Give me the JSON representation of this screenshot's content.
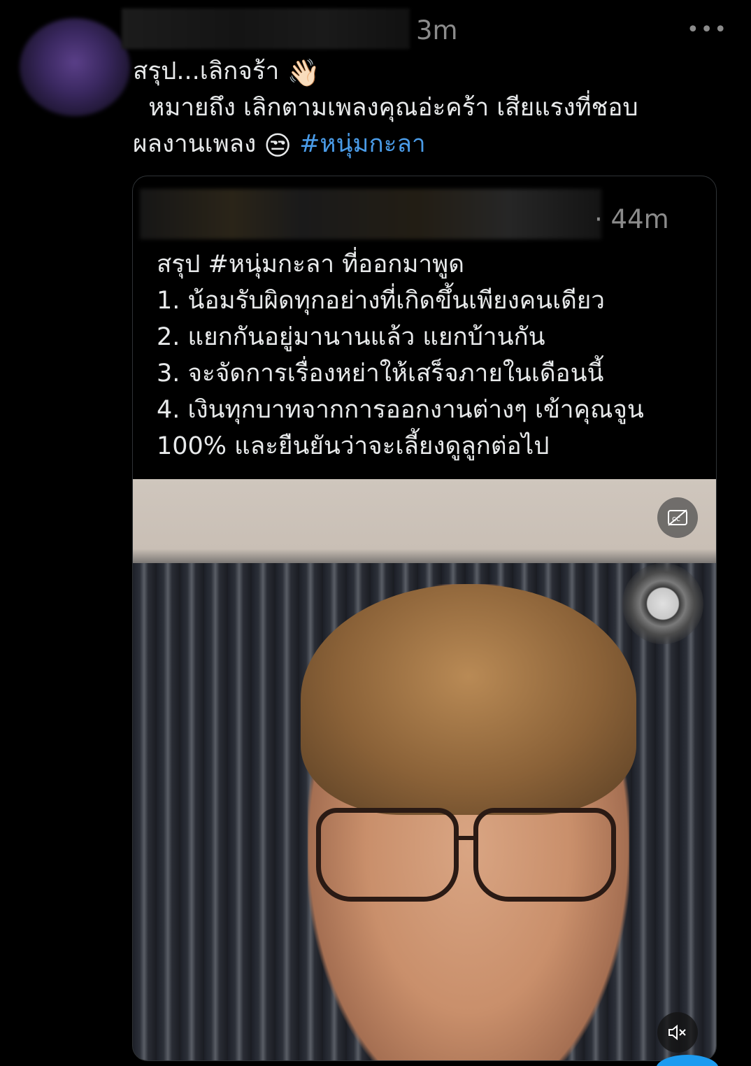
{
  "tweet": {
    "time": "3m",
    "more_label": "•••",
    "line1": "สรุป...เลิกจร้า",
    "line1_emoji": "👋🏻",
    "line2": "  หมายถึง เลิกตามเพลงคุณอ่ะคร้า เสียแรงที่ชอบ",
    "line3": "ผลงานเพลง",
    "line3_emoji": "😒",
    "hashtag": "#หนุ่มกะลา"
  },
  "quote": {
    "time": "· 44m",
    "lines": [
      "สรุป #หนุ่มกะลา ที่ออกมาพูด",
      "1. น้อมรับผิดทุกอย่างที่เกิดขึ้นเพียงคนเดียว",
      "2. แยกกันอยู่มานานแล้ว แยกบ้านกัน",
      "3. จะจัดการเรื่องหย่าให้เสร็จภายในเดือนนี้",
      "4. เงินทุกบาทจากการออกงานต่างๆ เข้าคุณจูน",
      "100% และยืนยันว่าจะเลี้ยงดูลูกต่อไป"
    ]
  },
  "video": {
    "cc_icon": "cc-off-icon",
    "cc_label": "⊘cc",
    "record_icon": "record-icon",
    "mute_icon": "mute-icon",
    "mute_label": "🔇"
  }
}
